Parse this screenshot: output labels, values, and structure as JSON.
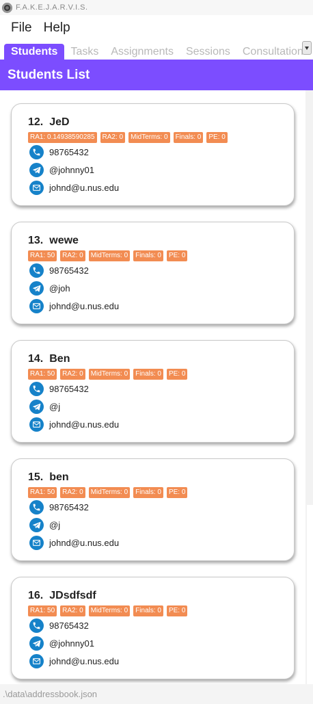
{
  "window": {
    "title": "F.A.K.E.J.A.R.V.I.S."
  },
  "menu": {
    "items": [
      "File",
      "Help"
    ]
  },
  "tabs": [
    "Students",
    "Tasks",
    "Assignments",
    "Sessions",
    "Consultations"
  ],
  "active_tab": "Students",
  "header": {
    "title": "Students List"
  },
  "accent_color": "#7c4dff",
  "tag_color": "#f28c52",
  "icon_color": "#1682c9",
  "students": [
    {
      "index": "12.",
      "name": "JeD",
      "tags": [
        "RA1: 0.14938590285",
        "RA2: 0",
        "MidTerms: 0",
        "Finals: 0",
        "PE: 0"
      ],
      "phone": "98765432",
      "telegram": "@johnny01",
      "email": "johnd@u.nus.edu"
    },
    {
      "index": "13.",
      "name": "wewe",
      "tags": [
        "RA1: 50",
        "RA2: 0",
        "MidTerms: 0",
        "Finals: 0",
        "PE: 0"
      ],
      "phone": "98765432",
      "telegram": "@joh",
      "email": "johnd@u.nus.edu"
    },
    {
      "index": "14.",
      "name": "Ben",
      "tags": [
        "RA1: 50",
        "RA2: 0",
        "MidTerms: 0",
        "Finals: 0",
        "PE: 0"
      ],
      "phone": "98765432",
      "telegram": "@j",
      "email": "johnd@u.nus.edu"
    },
    {
      "index": "15.",
      "name": "ben",
      "tags": [
        "RA1: 50",
        "RA2: 0",
        "MidTerms: 0",
        "Finals: 0",
        "PE: 0"
      ],
      "phone": "98765432",
      "telegram": "@j",
      "email": "johnd@u.nus.edu"
    },
    {
      "index": "16.",
      "name": "JDsdfsdf",
      "tags": [
        "RA1: 50",
        "RA2: 0",
        "MidTerms: 0",
        "Finals: 0",
        "PE: 0"
      ],
      "phone": "98765432",
      "telegram": "@johnny01",
      "email": "johnd@u.nus.edu"
    }
  ],
  "status": {
    "path": ".\\data\\addressbook.json"
  }
}
